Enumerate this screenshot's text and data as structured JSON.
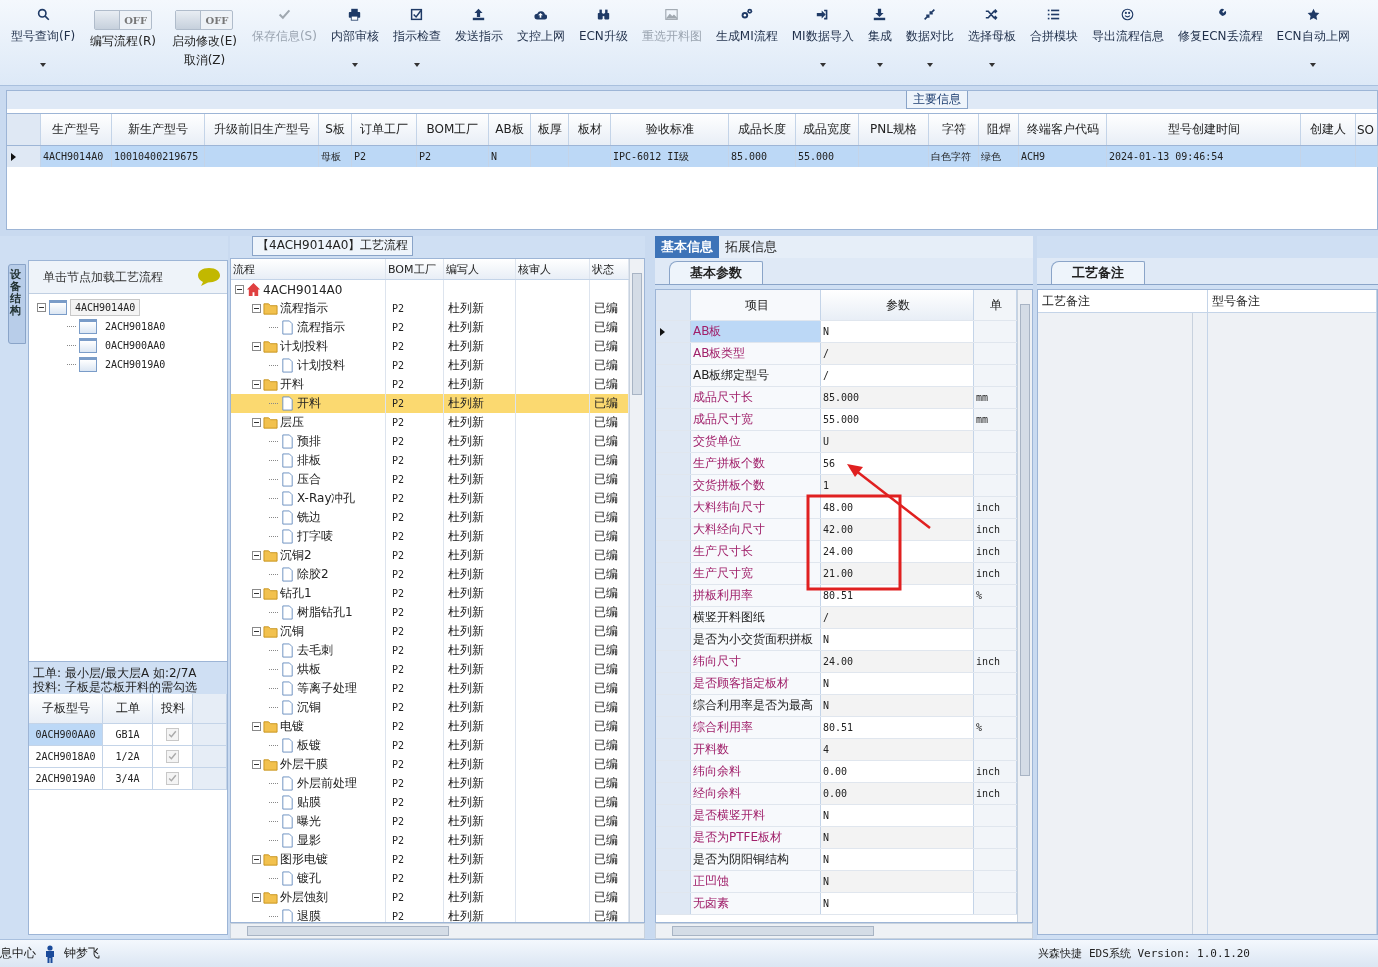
{
  "toolbar": [
    {
      "kind": "button",
      "label": "型号查询(F)",
      "dropdown": true,
      "disabled": false
    },
    {
      "kind": "toggle",
      "switch": "OFF",
      "on": false,
      "label": "编写流程(R)"
    },
    {
      "kind": "toggle",
      "switch": "OFF",
      "on": false,
      "label": "启动修改(E)",
      "sublabel": "取消(Z)"
    },
    {
      "kind": "button",
      "label": "保存信息(S)",
      "dropdown": false,
      "disabled": true
    },
    {
      "kind": "button",
      "label": "内部审核",
      "dropdown": true,
      "disabled": false
    },
    {
      "kind": "button",
      "label": "指示检查",
      "dropdown": true,
      "disabled": false
    },
    {
      "kind": "button",
      "label": "发送指示",
      "dropdown": false,
      "disabled": false
    },
    {
      "kind": "button",
      "label": "文控上网",
      "dropdown": false,
      "disabled": false
    },
    {
      "kind": "button",
      "label": "ECN升级",
      "dropdown": false,
      "disabled": false
    },
    {
      "kind": "button",
      "label": "重选开料图",
      "dropdown": false,
      "disabled": true
    },
    {
      "kind": "button",
      "label": "生成MI流程",
      "dropdown": false,
      "disabled": false
    },
    {
      "kind": "button",
      "label": "MI数据导入",
      "dropdown": true,
      "disabled": false
    },
    {
      "kind": "button",
      "label": "集成",
      "dropdown": true,
      "disabled": false
    },
    {
      "kind": "button",
      "label": "数据对比",
      "dropdown": true,
      "disabled": false
    },
    {
      "kind": "button",
      "label": "选择母板",
      "dropdown": true,
      "disabled": false
    },
    {
      "kind": "button",
      "label": "合拼模块",
      "dropdown": false,
      "disabled": false
    },
    {
      "kind": "button",
      "label": "导出流程信息",
      "dropdown": false,
      "disabled": false
    },
    {
      "kind": "button",
      "label": "修复ECN丢流程",
      "dropdown": false,
      "disabled": false
    },
    {
      "kind": "button",
      "label": "ECN自动上网",
      "dropdown": true,
      "disabled": false
    }
  ],
  "main_info": {
    "title": "主要信息",
    "columns": [
      "生产型号",
      "新生产型号",
      "升级前旧生产型号",
      "S板",
      "订单工厂",
      "BOM工厂",
      "AB板",
      "板厚",
      "板材",
      "验收标准",
      "成品长度",
      "成品宽度",
      "PNL规格",
      "字符",
      "阻焊",
      "终端客户代码",
      "型号创建时间",
      "创建人",
      "SO"
    ],
    "rows": [
      {
        "selected": true,
        "cells": [
          "4ACH9014A0",
          "10010400219675",
          null,
          "母板",
          "P2",
          "P2",
          "N",
          null,
          null,
          "IPC-6012 II级",
          "85.000",
          "55.000",
          null,
          "白色字符",
          "绿色",
          "ACH9",
          "2024-01-13 09:46:54",
          null,
          null
        ]
      }
    ]
  },
  "structure": {
    "tab": "设备结构",
    "hint": "单击节点加载工艺流程",
    "tree": [
      {
        "label": "4ACH9014A0",
        "expanded": true,
        "selected": true,
        "children": [
          {
            "label": "2ACH9018A0",
            "selected": false
          },
          {
            "label": "0ACH900AA0",
            "selected": false
          },
          {
            "label": "2ACH9019A0",
            "selected": false
          }
        ]
      }
    ],
    "notes": [
      "工单: 最小层/最大层A 如:2/7A",
      "投料: 子板是芯板开料的需勾选"
    ],
    "columns": [
      "子板型号",
      "工单",
      "投料"
    ],
    "rows": [
      {
        "board": "0ACH900AA0",
        "order": "GB1A",
        "checked": true,
        "disabled": true,
        "selected": true
      },
      {
        "board": "2ACH9018A0",
        "order": "1/2A",
        "checked": true,
        "disabled": true,
        "selected": false
      },
      {
        "board": "2ACH9019A0",
        "order": "3/4A",
        "checked": true,
        "disabled": true,
        "selected": false
      }
    ]
  },
  "flow": {
    "title": "【4ACH9014A0】工艺流程",
    "columns": [
      "流程",
      "BOM工厂",
      "编写人",
      "核审人",
      "状态"
    ],
    "tree": [
      {
        "label": "4ACH9014A0",
        "kind": "root",
        "expanded": true,
        "selected": false,
        "children": [
          {
            "label": "流程指示",
            "kind": "folder",
            "expanded": true,
            "selected": false,
            "bom": "P2",
            "writer": "杜列新",
            "status": "已编",
            "children": [
              {
                "label": "流程指示",
                "kind": "step",
                "selected": false,
                "bom": "P2",
                "writer": "杜列新",
                "status": "已编"
              }
            ]
          },
          {
            "label": "计划投料",
            "kind": "folder",
            "expanded": true,
            "selected": false,
            "bom": "P2",
            "writer": "杜列新",
            "status": "已编",
            "children": [
              {
                "label": "计划投料",
                "kind": "step",
                "selected": false,
                "bom": "P2",
                "writer": "杜列新",
                "status": "已编"
              }
            ]
          },
          {
            "label": "开料",
            "kind": "folder",
            "expanded": true,
            "selected": false,
            "bom": "P2",
            "writer": "杜列新",
            "status": "已编",
            "children": [
              {
                "label": "开料",
                "kind": "step",
                "selected": true,
                "bom": "P2",
                "writer": "杜列新",
                "status": "已编"
              }
            ]
          },
          {
            "label": "层压",
            "kind": "folder",
            "expanded": true,
            "selected": false,
            "bom": "P2",
            "writer": "杜列新",
            "status": "已编",
            "children": [
              {
                "label": "预排",
                "kind": "step",
                "selected": false,
                "bom": "P2",
                "writer": "杜列新",
                "status": "已编"
              },
              {
                "label": "排板",
                "kind": "step",
                "selected": false,
                "bom": "P2",
                "writer": "杜列新",
                "status": "已编"
              },
              {
                "label": "压合",
                "kind": "step",
                "selected": false,
                "bom": "P2",
                "writer": "杜列新",
                "status": "已编"
              },
              {
                "label": "X-Ray冲孔",
                "kind": "step",
                "selected": false,
                "bom": "P2",
                "writer": "杜列新",
                "status": "已编"
              },
              {
                "label": "铣边",
                "kind": "step",
                "selected": false,
                "bom": "P2",
                "writer": "杜列新",
                "status": "已编"
              },
              {
                "label": "打字唛",
                "kind": "step",
                "selected": false,
                "bom": "P2",
                "writer": "杜列新",
                "status": "已编"
              }
            ]
          },
          {
            "label": "沉铜2",
            "kind": "folder",
            "expanded": true,
            "selected": false,
            "bom": "P2",
            "writer": "杜列新",
            "status": "已编",
            "children": [
              {
                "label": "除胶2",
                "kind": "step",
                "selected": false,
                "bom": "P2",
                "writer": "杜列新",
                "status": "已编"
              }
            ]
          },
          {
            "label": "钻孔1",
            "kind": "folder",
            "expanded": true,
            "selected": false,
            "bom": "P2",
            "writer": "杜列新",
            "status": "已编",
            "children": [
              {
                "label": "树脂钻孔1",
                "kind": "step",
                "selected": false,
                "bom": "P2",
                "writer": "杜列新",
                "status": "已编"
              }
            ]
          },
          {
            "label": "沉铜",
            "kind": "folder",
            "expanded": true,
            "selected": false,
            "bom": "P2",
            "writer": "杜列新",
            "status": "已编",
            "children": [
              {
                "label": "去毛刺",
                "kind": "step",
                "selected": false,
                "bom": "P2",
                "writer": "杜列新",
                "status": "已编"
              },
              {
                "label": "烘板",
                "kind": "step",
                "selected": false,
                "bom": "P2",
                "writer": "杜列新",
                "status": "已编"
              },
              {
                "label": "等离子处理",
                "kind": "step",
                "selected": false,
                "bom": "P2",
                "writer": "杜列新",
                "status": "已编"
              },
              {
                "label": "沉铜",
                "kind": "step",
                "selected": false,
                "bom": "P2",
                "writer": "杜列新",
                "status": "已编"
              }
            ]
          },
          {
            "label": "电镀",
            "kind": "folder",
            "expanded": true,
            "selected": false,
            "bom": "P2",
            "writer": "杜列新",
            "status": "已编",
            "children": [
              {
                "label": "板镀",
                "kind": "step",
                "selected": false,
                "bom": "P2",
                "writer": "杜列新",
                "status": "已编"
              }
            ]
          },
          {
            "label": "外层干膜",
            "kind": "folder",
            "expanded": true,
            "selected": false,
            "bom": "P2",
            "writer": "杜列新",
            "status": "已编",
            "children": [
              {
                "label": "外层前处理",
                "kind": "step",
                "selected": false,
                "bom": "P2",
                "writer": "杜列新",
                "status": "已编"
              },
              {
                "label": "贴膜",
                "kind": "step",
                "selected": false,
                "bom": "P2",
                "writer": "杜列新",
                "status": "已编"
              },
              {
                "label": "曝光",
                "kind": "step",
                "selected": false,
                "bom": "P2",
                "writer": "杜列新",
                "status": "已编"
              },
              {
                "label": "显影",
                "kind": "step",
                "selected": false,
                "bom": "P2",
                "writer": "杜列新",
                "status": "已编"
              }
            ]
          },
          {
            "label": "图形电镀",
            "kind": "folder",
            "expanded": true,
            "selected": false,
            "bom": "P2",
            "writer": "杜列新",
            "status": "已编",
            "children": [
              {
                "label": "镀孔",
                "kind": "step",
                "selected": false,
                "bom": "P2",
                "writer": "杜列新",
                "status": "已编"
              }
            ]
          },
          {
            "label": "外层蚀刻",
            "kind": "folder",
            "expanded": true,
            "selected": false,
            "bom": "P2",
            "writer": "杜列新",
            "status": "已编",
            "children": [
              {
                "label": "退膜",
                "kind": "step",
                "selected": false,
                "bom": "P2",
                "writer": "杜列新",
                "status": "已编"
              }
            ]
          }
        ]
      }
    ]
  },
  "info": {
    "tabs": [
      {
        "label": "基本信息",
        "selected": true
      },
      {
        "label": "拓展信息",
        "selected": false
      }
    ],
    "subtab": "基本参数",
    "columns": [
      "项目",
      "参数",
      "单"
    ],
    "rows": [
      {
        "item": "AB板",
        "value": "N",
        "highlighted": true,
        "selected": true
      },
      {
        "item": "AB板类型",
        "value": "/",
        "highlighted": true,
        "selected": false
      },
      {
        "item": "AB板绑定型号",
        "value": "/",
        "highlighted": false,
        "selected": false
      },
      {
        "item": "成品尺寸长",
        "value": "85.000",
        "unit": "mm",
        "highlighted": true,
        "selected": false
      },
      {
        "item": "成品尺寸宽",
        "value": "55.000",
        "unit": "mm",
        "highlighted": true,
        "selected": false
      },
      {
        "item": "交货单位",
        "value": "U",
        "highlighted": true,
        "selected": false
      },
      {
        "item": "生产拼板个数",
        "value": "56",
        "highlighted": true,
        "selected": false
      },
      {
        "item": "交货拼板个数",
        "value": "1",
        "highlighted": true,
        "selected": false
      },
      {
        "item": "大料纬向尺寸",
        "value": "48.00",
        "unit": "inch",
        "highlighted": true,
        "selected": false
      },
      {
        "item": "大料经向尺寸",
        "value": "42.00",
        "unit": "inch",
        "highlighted": true,
        "selected": false
      },
      {
        "item": "生产尺寸长",
        "value": "24.00",
        "unit": "inch",
        "highlighted": true,
        "selected": false
      },
      {
        "item": "生产尺寸宽",
        "value": "21.00",
        "unit": "inch",
        "highlighted": true,
        "selected": false
      },
      {
        "item": "拼板利用率",
        "value": "80.51",
        "unit": "%",
        "highlighted": true,
        "selected": false
      },
      {
        "item": "横竖开料图纸",
        "value": "/",
        "highlighted": false,
        "selected": false
      },
      {
        "item": "是否为小交货面积拼板",
        "value": "N",
        "highlighted": false,
        "selected": false
      },
      {
        "item": "纬向尺寸",
        "value": "24.00",
        "unit": "inch",
        "highlighted": true,
        "selected": false
      },
      {
        "item": "是否顾客指定板材",
        "value": "N",
        "highlighted": true,
        "selected": false
      },
      {
        "item": "综合利用率是否为最高",
        "value": "N",
        "highlighted": false,
        "selected": false
      },
      {
        "item": "综合利用率",
        "value": "80.51",
        "unit": "%",
        "highlighted": true,
        "selected": false
      },
      {
        "item": "开料数",
        "value": "4",
        "highlighted": true,
        "selected": false
      },
      {
        "item": "纬向余料",
        "value": "0.00",
        "unit": "inch",
        "highlighted": true,
        "selected": false
      },
      {
        "item": "经向余料",
        "value": "0.00",
        "unit": "inch",
        "highlighted": true,
        "selected": false
      },
      {
        "item": "是否横竖开料",
        "value": "N",
        "highlighted": true,
        "selected": false
      },
      {
        "item": "是否为PTFE板材",
        "value": "N",
        "highlighted": true,
        "selected": false
      },
      {
        "item": "是否为阴阳铜结构",
        "value": "N",
        "highlighted": false,
        "selected": false
      },
      {
        "item": "正凹蚀",
        "value": "N",
        "highlighted": true,
        "selected": false
      },
      {
        "item": "无卤素",
        "value": "N",
        "highlighted": true,
        "selected": false
      }
    ]
  },
  "remarks": {
    "tab": "工艺备注",
    "columns": [
      "工艺备注",
      "型号备注"
    ]
  },
  "status_bar": {
    "left": "息中心",
    "user": "钟梦飞",
    "right": "兴森快捷 EDS系统 Version: 1.0.1.20"
  }
}
